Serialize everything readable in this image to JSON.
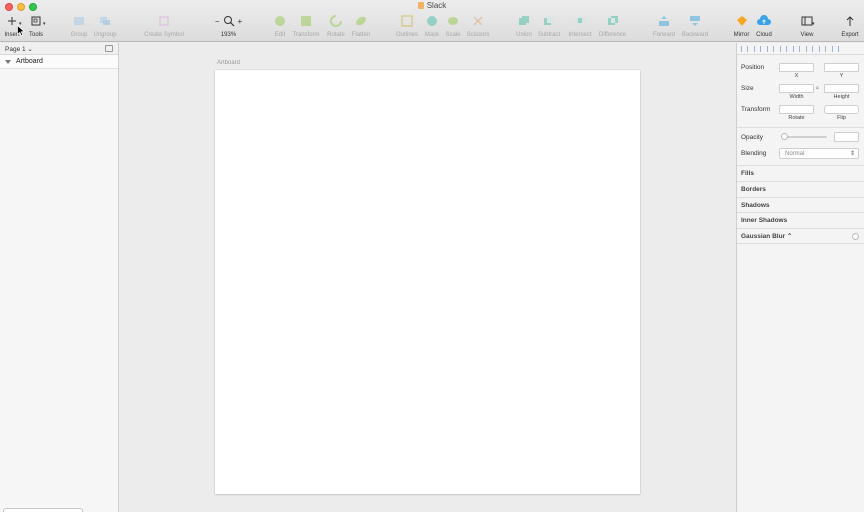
{
  "window": {
    "title": "Slack"
  },
  "colors": {
    "accent_green": "#8cc63e",
    "accent_teal": "#39b8a0",
    "accent_blue": "#2aa0e0",
    "mirror_orange": "#f6a623",
    "cloud_blue": "#3aa3e8"
  },
  "toolbar": {
    "insert": {
      "label": "Insert",
      "icon": "plus-icon"
    },
    "tools": {
      "label": "Tools",
      "icon": "tools-icon"
    },
    "group": {
      "label": "Group",
      "icon": "group-icon"
    },
    "ungroup": {
      "label": "Ungroup",
      "icon": "ungroup-icon"
    },
    "create_symbol": {
      "label": "Create Symbol",
      "icon": "symbol-icon"
    },
    "zoom": {
      "value": "193%",
      "minus": "−",
      "plus": "+",
      "icon": "magnifier-icon"
    },
    "edit": {
      "label": "Edit"
    },
    "transform": {
      "label": "Transform"
    },
    "rotate": {
      "label": "Rotate"
    },
    "flatten": {
      "label": "Flatten"
    },
    "outlines": {
      "label": "Outlines"
    },
    "mask": {
      "label": "Mask"
    },
    "scale": {
      "label": "Scale"
    },
    "scissors": {
      "label": "Scissors"
    },
    "union": {
      "label": "Union"
    },
    "subtract": {
      "label": "Subtract"
    },
    "intersect": {
      "label": "Intersect"
    },
    "difference": {
      "label": "Difference"
    },
    "forward": {
      "label": "Forward"
    },
    "backward": {
      "label": "Backward"
    },
    "mirror": {
      "label": "Mirror"
    },
    "cloud": {
      "label": "Cloud"
    },
    "view": {
      "label": "View"
    },
    "export": {
      "label": "Export"
    }
  },
  "left_panel": {
    "page_selector": "Page 1 ⌄",
    "layers": [
      {
        "name": "Artboard"
      }
    ]
  },
  "canvas": {
    "artboard_label": "Artboard"
  },
  "inspector": {
    "position_label": "Position",
    "x_label": "X",
    "y_label": "Y",
    "size_label": "Size",
    "width_label": "Width",
    "height_label": "Height",
    "transform_label": "Transform",
    "rotate_label": "Rotate",
    "flip_label": "Flip",
    "opacity_label": "Opacity",
    "blending_label": "Blending",
    "blending_value": "Normal",
    "sections": [
      "Fills",
      "Borders",
      "Shadows",
      "Inner Shadows",
      "Gaussian Blur ⌃"
    ]
  }
}
